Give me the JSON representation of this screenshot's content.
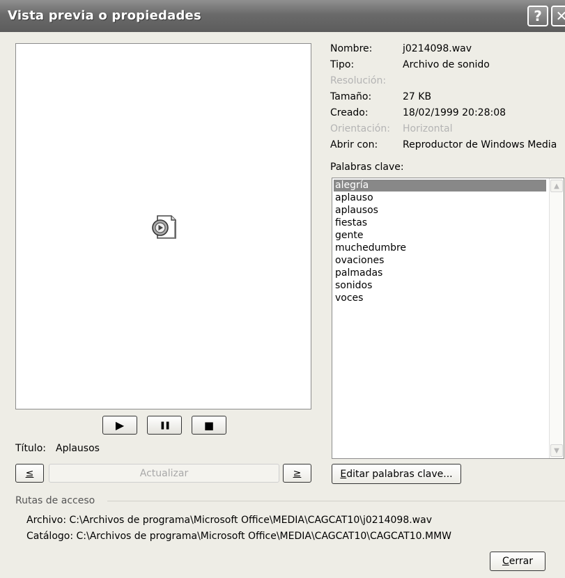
{
  "window": {
    "title": "Vista previa o propiedades",
    "help": "?",
    "close": "✕"
  },
  "player": {
    "play": "▶",
    "pause": "❚❚",
    "stop": "■"
  },
  "title_field": {
    "label": "Título:",
    "value": "Aplausos"
  },
  "nav": {
    "prev": "≤",
    "next": "≥",
    "update": "Actualizar"
  },
  "properties": [
    {
      "key": "Nombre:",
      "value": "j0214098.wav",
      "enabled": true
    },
    {
      "key": "Tipo:",
      "value": "Archivo de sonido",
      "enabled": true
    },
    {
      "key": "Resolución:",
      "value": "",
      "enabled": false
    },
    {
      "key": "Tamaño:",
      "value": "27 KB",
      "enabled": true
    },
    {
      "key": "Creado:",
      "value": "18/02/1999 20:28:08",
      "enabled": true
    },
    {
      "key": "Orientación:",
      "value": "Horizontal",
      "enabled": false
    },
    {
      "key": "Abrir con:",
      "value": "Reproductor de Windows Media",
      "enabled": true
    }
  ],
  "keywords": {
    "label": "Palabras clave:",
    "items": [
      "alegría",
      "aplauso",
      "aplausos",
      "fiestas",
      "gente",
      "muchedumbre",
      "ovaciones",
      "palmadas",
      "sonidos",
      "voces"
    ],
    "selected": 0,
    "edit_button": {
      "mnemonic": "E",
      "rest": "ditar palabras clave..."
    }
  },
  "paths": {
    "group_label": "Rutas de acceso",
    "file": {
      "label": "Archivo:",
      "value": "C:\\Archivos de programa\\Microsoft Office\\MEDIA\\CAGCAT10\\j0214098.wav"
    },
    "catalog": {
      "label": "Catálogo:",
      "value": "C:\\Archivos de programa\\Microsoft Office\\MEDIA\\CAGCAT10\\CAGCAT10.MMW"
    }
  },
  "close_button": {
    "mnemonic": "C",
    "rest": "errar"
  },
  "colors": {
    "titlebar": "#6a6a6a",
    "selection": "#888888",
    "dialog": "#eeede6"
  },
  "icons": {
    "preview": "sound-file-icon"
  }
}
